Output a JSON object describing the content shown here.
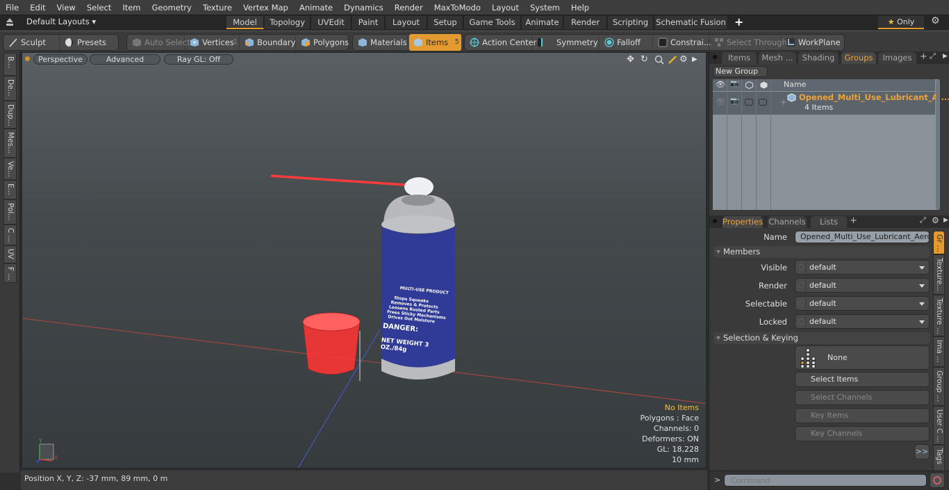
{
  "menu": [
    "File",
    "Edit",
    "View",
    "Select",
    "Item",
    "Geometry",
    "Texture",
    "Vertex Map",
    "Animate",
    "Dynamics",
    "Render",
    "MaxToModo",
    "Layout",
    "System",
    "Help"
  ],
  "layoutbar": {
    "layout_dropdown": "Default Layouts",
    "tabs": [
      "Model",
      "Topology",
      "UVEdit",
      "Paint",
      "Layout",
      "Setup",
      "Game Tools",
      "Animate",
      "Render",
      "Scripting",
      "Schematic Fusion"
    ],
    "active_tab": "Model",
    "add_tab": "+",
    "only_label": "Only"
  },
  "toolbar": {
    "sculpt": "Sculpt",
    "presets": "Presets",
    "auto_select": "Auto Select",
    "vertices": "Vertices",
    "vertices_count": "1",
    "boundary": "Boundary",
    "polygons": "Polygons",
    "materials": "Materials",
    "items": "Items",
    "items_count": "5",
    "action_center": "Action Center",
    "symmetry": "Symmetry",
    "falloff": "Falloff",
    "constraints": "Constrai...",
    "select_through": "Select Through",
    "workplane": "WorkPlane"
  },
  "left_strip": [
    "B...",
    "De...",
    "Dup...",
    "Mes...",
    "Ve...",
    "E...",
    "Pol...",
    "C ...",
    "UV",
    "F ..."
  ],
  "viewport": {
    "view_mode": "Perspective",
    "shading": "Advanced",
    "raygl": "Ray GL: Off",
    "hud": {
      "selection": "No Items",
      "polygons": "Polygons : Face",
      "channels": "Channels: 0",
      "deformers": "Deformers: ON",
      "gl": "GL: 18,228",
      "scale": "10 mm"
    },
    "colors": {
      "accent": "#e39b2f",
      "warn": "#f2c040",
      "can_blue": "#2e3a8c",
      "cap_red": "#ff3030"
    },
    "can_label": {
      "title": "MULTI-USE PRODUCT",
      "bullets": [
        "Stops Squeaks",
        "Removes & Protects",
        "Loosens Rusted Parts",
        "Frees Sticky Mechanisms",
        "Drives Out Moisture"
      ],
      "danger": "DANGER:",
      "net_weight": "NET WEIGHT 3 OZ./84g"
    }
  },
  "statusbar": {
    "position": "Position X, Y, Z:   -37 mm, 89 mm, 0 m"
  },
  "groups_panel": {
    "tabs": [
      "Items",
      "Mesh ...",
      "Shading",
      "Groups",
      "Images"
    ],
    "active_tab": "Groups",
    "new_group": "New Group",
    "column_name": "Name",
    "group_name": "Opened_Multi_Use_Lubricant_A ...",
    "group_count": "4 Items"
  },
  "properties_panel": {
    "tabs": [
      "Properties",
      "Channels",
      "Lists"
    ],
    "active_tab": "Properties",
    "name_label": "Name",
    "name_value": "Opened_Multi_Use_Lubricant_Aerosol",
    "members_section": "Members",
    "fields": [
      {
        "label": "Visible",
        "value": "default"
      },
      {
        "label": "Render",
        "value": "default"
      },
      {
        "label": "Selectable",
        "value": "default"
      },
      {
        "label": "Locked",
        "value": "default"
      }
    ],
    "keying_section": "Selection & Keying",
    "none_label": "None",
    "select_items": "Select Items",
    "select_channels": "Select Channels",
    "key_items": "Key Items",
    "key_channels": "Key Channels",
    "more": ">>",
    "side_tabs": [
      "Gr ...",
      "Texture...",
      "Texture ...",
      "Ima ...",
      "Group ...",
      "User C ...",
      "Tags"
    ]
  },
  "command": {
    "prompt": ">",
    "placeholder": "Command"
  }
}
